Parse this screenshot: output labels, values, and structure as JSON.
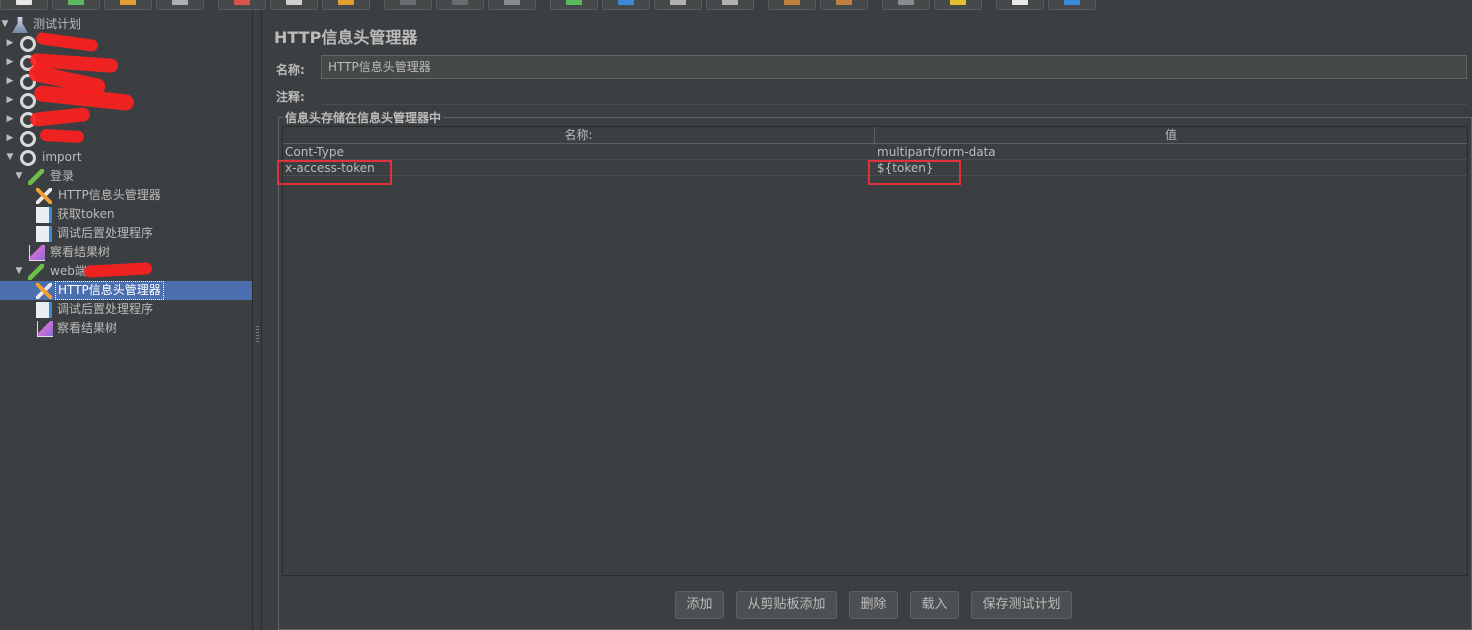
{
  "tree": {
    "root": {
      "label": "测试计划",
      "icon": "test-plan-flask-icon"
    },
    "groups": [
      {
        "label": "",
        "icon": "gear-icon",
        "redacted": true
      },
      {
        "label": "",
        "icon": "gear-icon",
        "redacted": true
      },
      {
        "label": "",
        "icon": "gear-icon",
        "redacted": true
      },
      {
        "label": "",
        "icon": "gear-icon",
        "redacted": true
      },
      {
        "label": "",
        "icon": "gear-icon",
        "redacted": true
      },
      {
        "label": "",
        "icon": "gear-icon",
        "redacted": true
      }
    ],
    "import_group": {
      "label": "import",
      "icon": "gear-icon",
      "children": [
        {
          "label": "登录",
          "icon": "sampler-pipette-icon",
          "children": [
            {
              "label": "HTTP信息头管理器",
              "icon": "wrench-icon"
            },
            {
              "label": "获取token",
              "icon": "document-icon"
            },
            {
              "label": "调试后置处理程序",
              "icon": "document-icon"
            }
          ]
        },
        {
          "label": "察看结果树",
          "icon": "chart-icon"
        },
        {
          "label": "web端",
          "icon": "sampler-pipette-icon",
          "redacted_suffix": true,
          "children": [
            {
              "label": "HTTP信息头管理器",
              "icon": "wrench-icon",
              "selected": true
            },
            {
              "label": "调试后置处理程序",
              "icon": "document-icon"
            },
            {
              "label": "察看结果树",
              "icon": "chart-icon"
            }
          ]
        }
      ]
    }
  },
  "panel": {
    "title": "HTTP信息头管理器",
    "name_label": "名称:",
    "name_value": "HTTP信息头管理器",
    "comment_label": "注释:",
    "group_title": "信息头存储在信息头管理器中",
    "table": {
      "headers": [
        "名称:",
        "值"
      ],
      "rows": [
        {
          "name": "Cont-Type",
          "value": "multipart/form-data"
        },
        {
          "name": "x-access-token",
          "value": "${token}"
        }
      ]
    },
    "buttons": [
      "添加",
      "从剪贴板添加",
      "删除",
      "载入",
      "保存测试计划"
    ]
  },
  "colors": {
    "background": "#3c3f41",
    "selection": "#4b6eaf",
    "highlight_box": "#e0323c",
    "text": "#bbbbbb"
  }
}
